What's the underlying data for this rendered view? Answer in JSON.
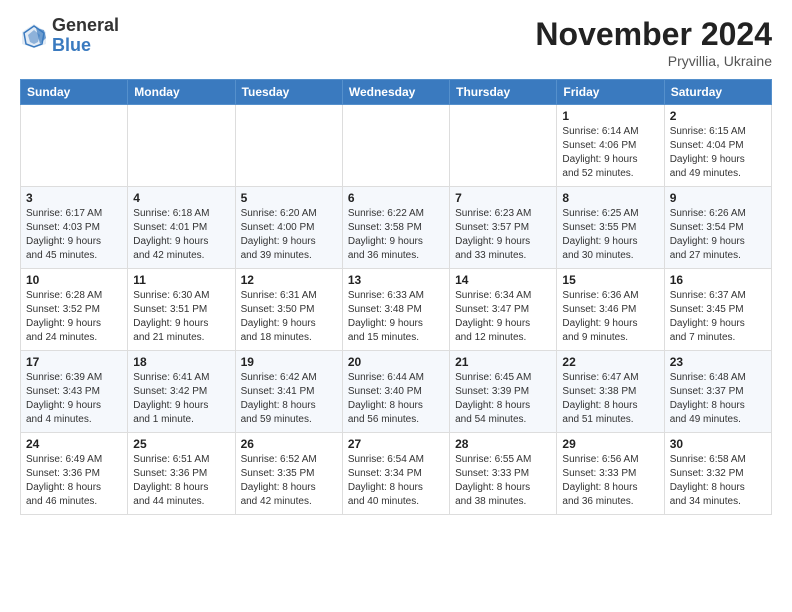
{
  "header": {
    "logo": {
      "general": "General",
      "blue": "Blue"
    },
    "title": "November 2024",
    "location": "Pryvillia, Ukraine"
  },
  "days_of_week": [
    "Sunday",
    "Monday",
    "Tuesday",
    "Wednesday",
    "Thursday",
    "Friday",
    "Saturday"
  ],
  "weeks": [
    [
      {
        "day": "",
        "info": ""
      },
      {
        "day": "",
        "info": ""
      },
      {
        "day": "",
        "info": ""
      },
      {
        "day": "",
        "info": ""
      },
      {
        "day": "",
        "info": ""
      },
      {
        "day": "1",
        "info": "Sunrise: 6:14 AM\nSunset: 4:06 PM\nDaylight: 9 hours\nand 52 minutes."
      },
      {
        "day": "2",
        "info": "Sunrise: 6:15 AM\nSunset: 4:04 PM\nDaylight: 9 hours\nand 49 minutes."
      }
    ],
    [
      {
        "day": "3",
        "info": "Sunrise: 6:17 AM\nSunset: 4:03 PM\nDaylight: 9 hours\nand 45 minutes."
      },
      {
        "day": "4",
        "info": "Sunrise: 6:18 AM\nSunset: 4:01 PM\nDaylight: 9 hours\nand 42 minutes."
      },
      {
        "day": "5",
        "info": "Sunrise: 6:20 AM\nSunset: 4:00 PM\nDaylight: 9 hours\nand 39 minutes."
      },
      {
        "day": "6",
        "info": "Sunrise: 6:22 AM\nSunset: 3:58 PM\nDaylight: 9 hours\nand 36 minutes."
      },
      {
        "day": "7",
        "info": "Sunrise: 6:23 AM\nSunset: 3:57 PM\nDaylight: 9 hours\nand 33 minutes."
      },
      {
        "day": "8",
        "info": "Sunrise: 6:25 AM\nSunset: 3:55 PM\nDaylight: 9 hours\nand 30 minutes."
      },
      {
        "day": "9",
        "info": "Sunrise: 6:26 AM\nSunset: 3:54 PM\nDaylight: 9 hours\nand 27 minutes."
      }
    ],
    [
      {
        "day": "10",
        "info": "Sunrise: 6:28 AM\nSunset: 3:52 PM\nDaylight: 9 hours\nand 24 minutes."
      },
      {
        "day": "11",
        "info": "Sunrise: 6:30 AM\nSunset: 3:51 PM\nDaylight: 9 hours\nand 21 minutes."
      },
      {
        "day": "12",
        "info": "Sunrise: 6:31 AM\nSunset: 3:50 PM\nDaylight: 9 hours\nand 18 minutes."
      },
      {
        "day": "13",
        "info": "Sunrise: 6:33 AM\nSunset: 3:48 PM\nDaylight: 9 hours\nand 15 minutes."
      },
      {
        "day": "14",
        "info": "Sunrise: 6:34 AM\nSunset: 3:47 PM\nDaylight: 9 hours\nand 12 minutes."
      },
      {
        "day": "15",
        "info": "Sunrise: 6:36 AM\nSunset: 3:46 PM\nDaylight: 9 hours\nand 9 minutes."
      },
      {
        "day": "16",
        "info": "Sunrise: 6:37 AM\nSunset: 3:45 PM\nDaylight: 9 hours\nand 7 minutes."
      }
    ],
    [
      {
        "day": "17",
        "info": "Sunrise: 6:39 AM\nSunset: 3:43 PM\nDaylight: 9 hours\nand 4 minutes."
      },
      {
        "day": "18",
        "info": "Sunrise: 6:41 AM\nSunset: 3:42 PM\nDaylight: 9 hours\nand 1 minute."
      },
      {
        "day": "19",
        "info": "Sunrise: 6:42 AM\nSunset: 3:41 PM\nDaylight: 8 hours\nand 59 minutes."
      },
      {
        "day": "20",
        "info": "Sunrise: 6:44 AM\nSunset: 3:40 PM\nDaylight: 8 hours\nand 56 minutes."
      },
      {
        "day": "21",
        "info": "Sunrise: 6:45 AM\nSunset: 3:39 PM\nDaylight: 8 hours\nand 54 minutes."
      },
      {
        "day": "22",
        "info": "Sunrise: 6:47 AM\nSunset: 3:38 PM\nDaylight: 8 hours\nand 51 minutes."
      },
      {
        "day": "23",
        "info": "Sunrise: 6:48 AM\nSunset: 3:37 PM\nDaylight: 8 hours\nand 49 minutes."
      }
    ],
    [
      {
        "day": "24",
        "info": "Sunrise: 6:49 AM\nSunset: 3:36 PM\nDaylight: 8 hours\nand 46 minutes."
      },
      {
        "day": "25",
        "info": "Sunrise: 6:51 AM\nSunset: 3:36 PM\nDaylight: 8 hours\nand 44 minutes."
      },
      {
        "day": "26",
        "info": "Sunrise: 6:52 AM\nSunset: 3:35 PM\nDaylight: 8 hours\nand 42 minutes."
      },
      {
        "day": "27",
        "info": "Sunrise: 6:54 AM\nSunset: 3:34 PM\nDaylight: 8 hours\nand 40 minutes."
      },
      {
        "day": "28",
        "info": "Sunrise: 6:55 AM\nSunset: 3:33 PM\nDaylight: 8 hours\nand 38 minutes."
      },
      {
        "day": "29",
        "info": "Sunrise: 6:56 AM\nSunset: 3:33 PM\nDaylight: 8 hours\nand 36 minutes."
      },
      {
        "day": "30",
        "info": "Sunrise: 6:58 AM\nSunset: 3:32 PM\nDaylight: 8 hours\nand 34 minutes."
      }
    ]
  ]
}
